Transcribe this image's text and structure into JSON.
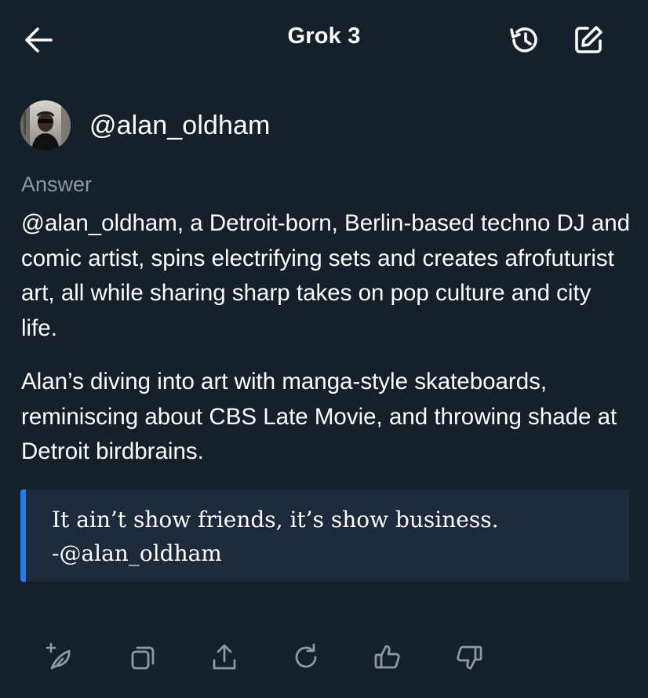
{
  "header": {
    "title": "Grok 3",
    "back_icon": "arrow-left-icon",
    "history_icon": "history-icon",
    "edit_icon": "compose-icon"
  },
  "user": {
    "handle": "@alan_oldham",
    "avatar": "avatar-photo"
  },
  "answer": {
    "label": "Answer",
    "paragraphs": [
      "@alan_oldham, a Detroit-born, Berlin-based techno DJ and comic artist, spins electrifying sets and creates afrofuturist art, all while sharing sharp takes on pop culture and city life.",
      "Alan’s diving into art with manga-style skateboards, reminiscing about CBS Late Movie, and throwing shade at Detroit birdbrains."
    ]
  },
  "quote": {
    "text": "It ain’t show friends, it’s show business.",
    "attribution": "-@alan_oldham"
  },
  "actions": [
    "regenerate-sparkle-icon",
    "copy-icon",
    "share-icon",
    "refresh-icon",
    "thumbs-up-icon",
    "thumbs-down-icon"
  ],
  "colors": {
    "background": "#15202b",
    "text": "#ffffff",
    "muted": "#8b98a5",
    "quote_bg": "#1c2a3c",
    "accent": "#1d7cf2",
    "icon": "#8b98a5"
  }
}
